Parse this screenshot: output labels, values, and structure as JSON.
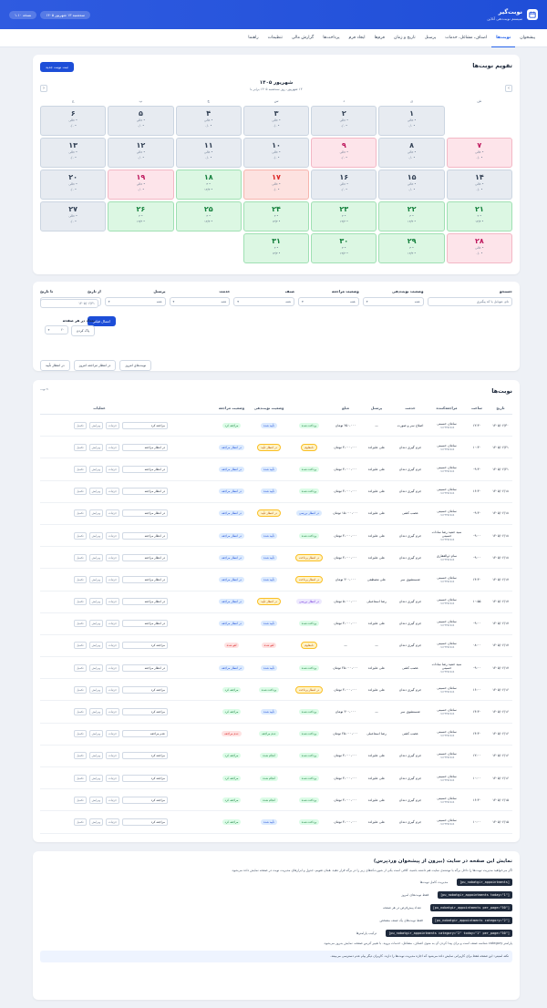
{
  "topbar": {
    "title": "نوبت‌گیر",
    "subtitle": "سیستم نوبت‌دهی آنلاین",
    "date_pill": "سه‌شنبه ۱۳ شهریور ۱۴۰۵",
    "version_pill": "نسخه ۱.۱۰"
  },
  "nav": [
    "پیشخوان",
    "نوبت‌ها",
    "اصناف، مشاغل، خدمات",
    "پرسنل",
    "تاریخ و زمان",
    "فرم‌ها",
    "ایجاد فرم",
    "پرداخت‌ها",
    "گزارش مالی",
    "تنظیمات",
    "راهنما"
  ],
  "calendar": {
    "title": "تقویم نوبت‌ها",
    "new_button": "ثبت نوبت جدید",
    "month": "شهریور ۱۴۰۵",
    "month_sub": "۱۳ شهریور، روز سه‌شنبه ۱۴۰۵ برابر با",
    "prev": "‹",
    "next": "›",
    "weekdays": [
      "ش",
      "ی",
      "د",
      "س",
      "چ",
      "پ",
      "ج"
    ],
    "days": [
      {
        "n": "",
        "c": "blank",
        "a": "",
        "b": ""
      },
      {
        "n": "۱",
        "c": "gray",
        "a": "• خالی",
        "b": "• ۰/۰"
      },
      {
        "n": "۲",
        "c": "gray",
        "a": "• خالی",
        "b": "• ۰/۰"
      },
      {
        "n": "۳",
        "c": "gray",
        "a": "• خالی",
        "b": "• ۰/۰"
      },
      {
        "n": "۴",
        "c": "gray",
        "a": "• خالی",
        "b": "• ۰/۰"
      },
      {
        "n": "۵",
        "c": "gray",
        "a": "• خالی",
        "b": "• ۰/۰"
      },
      {
        "n": "۶",
        "c": "gray",
        "a": "• خالی",
        "b": "• ۰/۰"
      },
      {
        "n": "۷",
        "c": "pink",
        "a": "• خالی",
        "b": "• ۰/۰"
      },
      {
        "n": "۸",
        "c": "gray",
        "a": "• خالی",
        "b": "• ۰/۰"
      },
      {
        "n": "۹",
        "c": "pink",
        "a": "• خالی",
        "b": "• ۰/۰"
      },
      {
        "n": "۱۰",
        "c": "gray",
        "a": "• خالی",
        "b": "• ۰/۰"
      },
      {
        "n": "۱۱",
        "c": "gray",
        "a": "• خالی",
        "b": "• ۰/۰"
      },
      {
        "n": "۱۲",
        "c": "gray",
        "a": "• خالی",
        "b": "• ۰/۰"
      },
      {
        "n": "۱۳",
        "c": "gray",
        "a": "• خالی",
        "b": "• ۰/۰"
      },
      {
        "n": "۱۴",
        "c": "gray",
        "a": "• خالی",
        "b": "• ۰/۰"
      },
      {
        "n": "۱۵",
        "c": "gray",
        "a": "• خالی",
        "b": "• ۰/۰"
      },
      {
        "n": "۱۶",
        "c": "gray",
        "a": "• خالی",
        "b": "• ۰/۰"
      },
      {
        "n": "۱۷",
        "c": "red",
        "a": "• خالی",
        "b": "• ۰/۰"
      },
      {
        "n": "۱۸",
        "c": "green",
        "a": "• ۳",
        "b": "• ۱۳/۳"
      },
      {
        "n": "۱۹",
        "c": "pink",
        "a": "• خالی",
        "b": "• ۰/۰"
      },
      {
        "n": "۲۰",
        "c": "gray",
        "a": "• خالی",
        "b": "• ۰/۰"
      },
      {
        "n": "۲۱",
        "c": "green",
        "a": "• ۳",
        "b": "• ۱۳/۳"
      },
      {
        "n": "۲۲",
        "c": "green",
        "a": "• ۳",
        "b": "• ۱۳/۳"
      },
      {
        "n": "۲۳",
        "c": "green",
        "a": "• ۳",
        "b": "• ۱۳/۳"
      },
      {
        "n": "۲۴",
        "c": "green",
        "a": "• ۳",
        "b": "• ۱۳/۳"
      },
      {
        "n": "۲۵",
        "c": "green",
        "a": "• ۳",
        "b": "• ۱۳/۳"
      },
      {
        "n": "۲۶",
        "c": "green",
        "a": "• ۳",
        "b": "• ۱۳/۳"
      },
      {
        "n": "۲۷",
        "c": "gray",
        "a": "• خالی",
        "b": "• ۰/۰"
      },
      {
        "n": "۲۸",
        "c": "pink",
        "a": "• خالی",
        "b": "• ۰/۰"
      },
      {
        "n": "۲۹",
        "c": "green",
        "a": "• ۳",
        "b": "• ۱۳/۳"
      },
      {
        "n": "۳۰",
        "c": "green",
        "a": "• ۳",
        "b": "• ۱۳/۳"
      },
      {
        "n": "۳۱",
        "c": "green",
        "a": "• ۳",
        "b": "• ۱۳/۳"
      }
    ]
  },
  "filter": {
    "labels": [
      "جستجو",
      "وضعیت نوبت‌دهی",
      "وضعیت مراجعه",
      "صنف",
      "خدمت",
      "پرسنل",
      "از تاریخ",
      "تا تاریخ"
    ],
    "search_placeholder": "نام، موبایل یا کد پیگیری",
    "selects": [
      "همه",
      "همه",
      "همه",
      "همه",
      "همه"
    ],
    "from_date": "۱۴۰۵/۰۶/۰۱",
    "to_date": "۱۴۰۵/۰۶/۳۱",
    "apply": "اعمال فیلتر",
    "per_page_label": "تعداد در هر صفحه",
    "per_page_value": "۲۰",
    "clear": "پاک کردن",
    "quick": [
      "نوبت‌های امروز",
      "در انتظار مراجعه امروز",
      "در انتظار تأیید"
    ]
  },
  "table": {
    "title": "نوبت‌ها",
    "count": "۲۱ نوبت",
    "headers": [
      "تاریخ",
      "ساعت",
      "مراجعه‌کننده",
      "خدمت",
      "پرسنل",
      "مبلغ",
      "وضعیت نوبت‌دهی",
      "وضعیت مراجعه",
      "عملیات"
    ],
    "op_details": "جزئیات",
    "op_edit": "ویرایش",
    "op_complete": "تکمیل",
    "rows": [
      {
        "date": "۱۴۰۵/۰۶/۳۰",
        "time": "۱۲:۳۰",
        "client": "سامان حسینی",
        "phone": "۰۹۱۲۳۴۵۶۷۸۹",
        "service": "اصلاح سر و صورت",
        "staff": "—",
        "amount": "۲۵۰،۰۰۰ تومان",
        "pay": "پرداخت شده",
        "pay_c": "b-green",
        "status": "تأیید شده",
        "status_c": "b-blue",
        "visit": "مراجعه کرد",
        "visit_c": "b-green",
        "select": "مراجعه کرد"
      },
      {
        "date": "۱۴۰۵/۰۶/۲۱",
        "time": "۱۰:۳۰",
        "client": "سامان حسینی",
        "phone": "۰۹۱۲۳۴۵۶۷۸۹",
        "service": "جرم گیری دندان",
        "staff": "علی علیزاده",
        "amount": "۳،۰۰۰،۰۰۰ تومان",
        "pay": "نامعلوم",
        "pay_c": "b-yellow",
        "status": "در انتظار تأیید",
        "status_c": "b-yellow",
        "visit": "در انتظار مراجعه",
        "visit_c": "b-blue",
        "select": "در انتظار مراجعه"
      },
      {
        "date": "۱۴۰۵/۰۶/۲۱",
        "time": "۰۹:۳۰",
        "client": "سامان حسینی",
        "phone": "۰۹۱۲۳۴۵۶۷۸۹",
        "service": "جرم گیری دندان",
        "staff": "علی علیزاده",
        "amount": "۳،۰۰۰،۰۰۰ تومان",
        "pay": "پرداخت شده",
        "pay_c": "b-green",
        "status": "تأیید شده",
        "status_c": "b-blue",
        "visit": "در انتظار مراجعه",
        "visit_c": "b-blue",
        "select": "در انتظار مراجعه"
      },
      {
        "date": "۱۴۰۵/۰۶/۱۸",
        "time": "۱۶:۳۰",
        "client": "سامان حسینی",
        "phone": "۰۹۱۲۳۴۵۶۷۸۹",
        "service": "جرم گیری دندان",
        "staff": "علی علیزاده",
        "amount": "۳،۰۰۰،۰۰۰ تومان",
        "pay": "پرداخت شده",
        "pay_c": "b-green",
        "status": "تأیید شده",
        "status_c": "b-blue",
        "visit": "در انتظار مراجعه",
        "visit_c": "b-blue",
        "select": "در انتظار مراجعه"
      },
      {
        "date": "۱۴۰۵/۰۶/۱۸",
        "time": "۰۹:۳۰",
        "client": "سامان حسینی",
        "phone": "۰۹۱۲۳۴۵۶۷۸۹",
        "service": "عصب کشی",
        "staff": "علی علیزاده",
        "amount": "۱۵،۰۰۰،۰۰۰ تومان",
        "pay": "در انتظار بررسی",
        "pay_c": "b-blue",
        "status": "در انتظار تأیید",
        "status_c": "b-yellow",
        "visit": "در انتظار مراجعه",
        "visit_c": "b-blue",
        "select": "در انتظار مراجعه"
      },
      {
        "date": "۱۴۰۵/۰۶/۱۸",
        "time": "۰۹:۰۰",
        "client": "سید حمید رضا سادات حسینی",
        "phone": "۰۹۱۲۳۴۵۶۷۸۹",
        "service": "جرم گیری دندان",
        "staff": "علی علیزاده",
        "amount": "۳،۰۰۰،۰۰۰ تومان",
        "pay": "پرداخت شده",
        "pay_c": "b-green",
        "status": "تأیید شده",
        "status_c": "b-blue",
        "visit": "در انتظار مراجعه",
        "visit_c": "b-blue",
        "select": "در انتظار مراجعه"
      },
      {
        "date": "۱۴۰۵/۰۶/۱۸",
        "time": "۰۹:۰۰",
        "client": "سام ذوالفقاری",
        "phone": "۰۹۱۲۳۴۵۶۷۸۹",
        "service": "جرم گیری دندان",
        "staff": "علی علیزاده",
        "amount": "۳،۰۰۰،۰۰۰ تومان",
        "pay": "در انتظار پرداخت",
        "pay_c": "b-yellow",
        "status": "تأیید شده",
        "status_c": "b-blue",
        "visit": "در انتظار مراجعه",
        "visit_c": "b-blue",
        "select": "در انتظار مراجعه"
      },
      {
        "date": "۱۴۰۵/۰۶/۱۷",
        "time": "۱۴:۳۰",
        "client": "سامان حسینی",
        "phone": "۰۹۱۲۳۴۵۶۷۸۹",
        "service": "شستشوی سر",
        "staff": "علی مصطفی",
        "amount": "۳۰۰،۰۰۰ تومان",
        "pay": "در انتظار پرداخت",
        "pay_c": "b-yellow",
        "status": "تأیید شده",
        "status_c": "b-blue",
        "visit": "در انتظار مراجعه",
        "visit_c": "b-blue",
        "select": "در انتظار مراجعه"
      },
      {
        "date": "۱۴۰۵/۰۶/۱۷",
        "time": "۱۰:۵۵",
        "client": "سامان حسینی",
        "phone": "۰۹۱۲۳۴۵۶۷۸۹",
        "service": "جرم گیری دندان",
        "staff": "رضا اسماعیلی",
        "amount": "۵،۰۰۰،۰۰۰ تومان",
        "pay": "در انتظار بررسی",
        "pay_c": "b-purple",
        "status": "در انتظار تأیید",
        "status_c": "b-yellow",
        "visit": "در انتظار مراجعه",
        "visit_c": "b-blue",
        "select": "در انتظار مراجعه"
      },
      {
        "date": "۱۴۰۵/۰۶/۱۷",
        "time": "۰۹:۰۰",
        "client": "سامان حسینی",
        "phone": "۰۹۱۲۳۴۵۶۷۸۹",
        "service": "جرم گیری دندان",
        "staff": "علی علیزاده",
        "amount": "۳،۰۰۰،۰۰۰ تومان",
        "pay": "پرداخت شده",
        "pay_c": "b-green",
        "status": "تأیید شده",
        "status_c": "b-blue",
        "visit": "در انتظار مراجعه",
        "visit_c": "b-blue",
        "select": "در انتظار مراجعه"
      },
      {
        "date": "۱۴۰۵/۰۶/۱۷",
        "time": "۰۸:۰۰",
        "client": "سامان حسینی",
        "phone": "۰۹۱۲۳۴۵۶۷۸۹",
        "service": "جرم گیری دندان",
        "staff": "—",
        "amount": "—",
        "pay": "نامعلوم",
        "pay_c": "b-yellow",
        "status": "لغو شده",
        "status_c": "b-red",
        "visit": "لغو شده",
        "visit_c": "b-red",
        "select": "مراجعه کرد"
      },
      {
        "date": "۱۴۰۵/۰۶/۱۷",
        "time": "۰۹:۰۰",
        "client": "سید حمید رضا سادات حسینی",
        "phone": "۰۹۱۲۳۴۵۶۷۸۹",
        "service": "عصب کشی",
        "staff": "علی علیزاده",
        "amount": "۲۵،۰۰۰،۰۰۰ تومان",
        "pay": "پرداخت شده",
        "pay_c": "b-green",
        "status": "تأیید شده",
        "status_c": "b-blue",
        "visit": "در انتظار مراجعه",
        "visit_c": "b-blue",
        "select": "در انتظار مراجعه"
      },
      {
        "date": "۱۴۰۵/۰۶/۱۶",
        "time": "۱۶:۰۰",
        "client": "سامان حسینی",
        "phone": "۰۹۱۲۳۴۵۶۷۸۹",
        "service": "جرم گیری دندان",
        "staff": "علی علیزاده",
        "amount": "۳،۰۰۰،۰۰۰ تومان",
        "pay": "در انتظار پرداخت",
        "pay_c": "b-yellow",
        "status": "پرداخت شده",
        "status_c": "b-green",
        "visit": "مراجعه کرد",
        "visit_c": "b-green",
        "select": "مراجعه کرد"
      },
      {
        "date": "۱۴۰۵/۰۶/۱۶",
        "time": "۱۴:۳۰",
        "client": "سامان حسینی",
        "phone": "۰۹۱۲۳۴۵۶۷۸۹",
        "service": "شستشوی سر",
        "staff": "—",
        "amount": "۳۰۰،۰۰۰ تومان",
        "pay": "پرداخت شده",
        "pay_c": "b-green",
        "status": "تأیید شده",
        "status_c": "b-blue",
        "visit": "مراجعه کرد",
        "visit_c": "b-green",
        "select": "مراجعه کرد"
      },
      {
        "date": "۱۴۰۵/۰۶/۱۶",
        "time": "۱۴:۳۰",
        "client": "سامان حسینی",
        "phone": "۰۹۱۲۳۴۵۶۷۸۹",
        "service": "عصب کشی",
        "staff": "رضا اسماعیلی",
        "amount": "۲۵،۰۰۰،۰۰۰ تومان",
        "pay": "پرداخت شده",
        "pay_c": "b-green",
        "status": "عدم مراجعه",
        "status_c": "b-green",
        "visit": "عدم مراجعه",
        "visit_c": "b-red",
        "select": "عدم مراجعه"
      },
      {
        "date": "۱۴۰۵/۰۶/۱۶",
        "time": "۱۲:۰۰",
        "client": "سامان حسینی",
        "phone": "۰۹۱۲۳۴۵۶۷۸۹",
        "service": "جرم گیری دندان",
        "staff": "علی علیزاده",
        "amount": "۳،۰۰۰،۰۰۰ تومان",
        "pay": "پرداخت شده",
        "pay_c": "b-green",
        "status": "انجام شده",
        "status_c": "b-green",
        "visit": "مراجعه کرد",
        "visit_c": "b-green",
        "select": "مراجعه کرد"
      },
      {
        "date": "۱۴۰۵/۰۶/۱۶",
        "time": "۱۰:۰۰",
        "client": "سامان حسینی",
        "phone": "۰۹۱۲۳۴۵۶۷۸۹",
        "service": "جرم گیری دندان",
        "staff": "علی علیزاده",
        "amount": "۳،۰۰۰،۰۰۰ تومان",
        "pay": "پرداخت شده",
        "pay_c": "b-green",
        "status": "انجام شده",
        "status_c": "b-green",
        "visit": "مراجعه کرد",
        "visit_c": "b-green",
        "select": "مراجعه کرد"
      },
      {
        "date": "۱۴۰۵/۰۶/۱۵",
        "time": "۱۶:۳۰",
        "client": "سامان حسینی",
        "phone": "۰۹۱۲۳۴۵۶۷۸۹",
        "service": "جرم گیری دندان",
        "staff": "علی علیزاده",
        "amount": "۳،۰۰۰،۰۰۰ تومان",
        "pay": "پرداخت شده",
        "pay_c": "b-green",
        "status": "انجام شده",
        "status_c": "b-green",
        "visit": "مراجعه کرد",
        "visit_c": "b-green",
        "select": "مراجعه کرد"
      },
      {
        "date": "۱۴۰۵/۰۶/۱۵",
        "time": "۱۰:۰۰",
        "client": "سامان حسینی",
        "phone": "۰۹۱۲۳۴۵۶۷۸۹",
        "service": "جرم گیری دندان",
        "staff": "علی علیزاده",
        "amount": "۳،۰۰۰،۰۰۰ تومان",
        "pay": "پرداخت شده",
        "pay_c": "b-green",
        "status": "تأیید شده",
        "status_c": "b-blue",
        "visit": "مراجعه کرد",
        "visit_c": "b-green",
        "select": "مراجعه کرد"
      }
    ]
  },
  "shortcodes": {
    "title": "نمایش این صفحه در سایت (بیرون از پیشخوان وردپرس)",
    "desc": "اگر می‌خواهید مدیریت نوبت‌ها را داخل برگه یا نوشته‌ی سایت هم داشته باشید، کافی است یکی از شورت‌کدهای زیر را در برگه قرار دهید. همان تقویم، جدول و ابزارهای مدیریت نوبت در صفحه نمایش داده می‌شود.",
    "items": [
      {
        "code": "[pu_nobatgir_appointments]",
        "note": "مدیریت کامل نوبت‌ها"
      },
      {
        "code": "[pu_nobatgir_appointments today=\"1\"]",
        "note": "فقط نوبت‌های امروز"
      },
      {
        "code": "[pu_nobatgir_appointments per_page=\"50\"]",
        "note": "تعداد پیش‌فرض در هر صفحه"
      },
      {
        "code": "[pu_nobatgir_appointments category=\"2\"]",
        "note": "فقط نوبت‌های یک صنف مشخص"
      },
      {
        "code": "[pu_nobatgir_appointments category=\"2\" today=\"1\" per_page=\"50\"]",
        "note": "ترکیب پارامترها"
      }
    ],
    "param_note": "پارامتر category شناسه صنف است و برای پیدا کردن آن به منوی اصناف، مشاغل، خدمات بروید. با تغییر آدرس صفحه، نمایش به‌روز می‌شود.",
    "foot": "نکته امنیتی: این صفحه فقط برای کاربرانی نمایش داده می‌شود که اجازه مدیریت نوبت‌ها را دارند. کاربران دیگر پیام عدم دسترسی می‌بینند."
  },
  "colors": {
    "accent": "#1d4ed8",
    "topbar": "#2f5be0"
  }
}
